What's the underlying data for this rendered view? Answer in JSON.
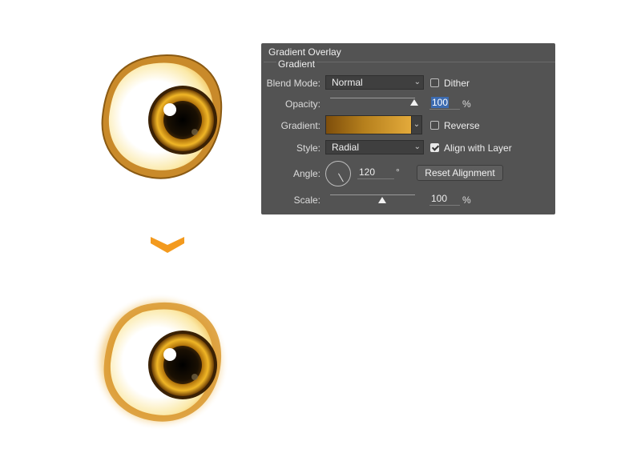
{
  "panel": {
    "title": "Gradient Overlay",
    "section": "Gradient",
    "blend_mode": {
      "label": "Blend Mode:",
      "value": "Normal"
    },
    "dither": {
      "label": "Dither",
      "checked": false
    },
    "opacity": {
      "label": "Opacity:",
      "value": "100",
      "unit": "%",
      "level": 1.0
    },
    "gradient": {
      "label": "Gradient:",
      "colors": [
        "#7e4e0b",
        "#b6801d",
        "#e3aa3b"
      ]
    },
    "reverse": {
      "label": "Reverse",
      "checked": false
    },
    "style": {
      "label": "Style:",
      "value": "Radial"
    },
    "align_with_layer": {
      "label": "Align with Layer",
      "checked": true
    },
    "angle": {
      "label": "Angle:",
      "value": "120",
      "unit": "°"
    },
    "reset_button": "Reset Alignment",
    "scale": {
      "label": "Scale:",
      "value": "100",
      "unit": "%",
      "level": 0.6
    }
  },
  "colors": {
    "arrow": "#f39a1e",
    "panel_bg": "#535353",
    "selection": "#3c6bb0",
    "iris_outer": "#7a4706",
    "iris_inner": "#e0a31c"
  },
  "icons": {
    "arrow": "chevron-down-icon",
    "checkbox": "checkbox-icon",
    "dropdown": "chevron-down-icon",
    "angle": "angle-dial-icon"
  }
}
